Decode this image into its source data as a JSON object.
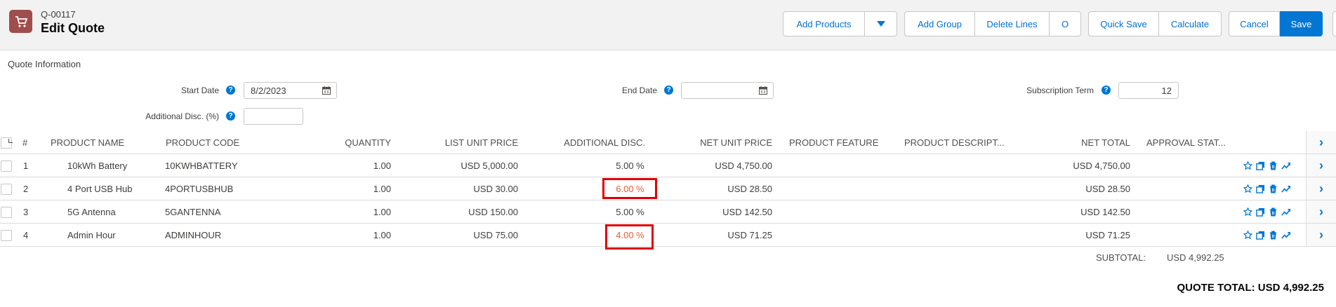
{
  "header": {
    "quote_id": "Q-00117",
    "title": "Edit Quote",
    "buttons": {
      "add_products": "Add Products",
      "add_group": "Add Group",
      "delete_lines": "Delete Lines",
      "circle": "O",
      "quick_save": "Quick Save",
      "calculate": "Calculate",
      "cancel": "Cancel",
      "save": "Save"
    }
  },
  "info": {
    "section_title": "Quote Information",
    "start_date_label": "Start Date",
    "start_date_value": "8/2/2023",
    "end_date_label": "End Date",
    "end_date_value": "",
    "subscription_term_label": "Subscription Term",
    "subscription_term_value": "12",
    "additional_disc_label": "Additional Disc. (%)",
    "additional_disc_value": ""
  },
  "table": {
    "columns": [
      "#",
      "PRODUCT NAME",
      "PRODUCT CODE",
      "QUANTITY",
      "LIST UNIT PRICE",
      "ADDITIONAL DISC.",
      "NET UNIT PRICE",
      "PRODUCT FEATURE",
      "PRODUCT DESCRIPT...",
      "NET TOTAL",
      "APPROVAL STAT..."
    ],
    "rows": [
      {
        "num": "1",
        "name": "10kWh Battery",
        "code": "10KWHBATTERY",
        "qty": "1.00",
        "list": "USD 5,000.00",
        "disc": "5.00 %",
        "net_unit": "USD 4,750.00",
        "feature": "",
        "desc": "",
        "net_total": "USD 4,750.00",
        "approval": "",
        "highlight": false
      },
      {
        "num": "2",
        "name": "4 Port USB Hub",
        "code": "4PORTUSBHUB",
        "qty": "1.00",
        "list": "USD 30.00",
        "disc": "6.00 %",
        "net_unit": "USD 28.50",
        "feature": "",
        "desc": "",
        "net_total": "USD 28.50",
        "approval": "",
        "highlight": true
      },
      {
        "num": "3",
        "name": "5G Antenna",
        "code": "5GANTENNA",
        "qty": "1.00",
        "list": "USD 150.00",
        "disc": "5.00 %",
        "net_unit": "USD 142.50",
        "feature": "",
        "desc": "",
        "net_total": "USD 142.50",
        "approval": "",
        "highlight": false
      },
      {
        "num": "4",
        "name": "Admin Hour",
        "code": "ADMINHOUR",
        "qty": "1.00",
        "list": "USD 75.00",
        "disc": "4.00 %",
        "net_unit": "USD 71.25",
        "feature": "",
        "desc": "",
        "net_total": "USD 71.25",
        "approval": "",
        "highlight": true
      }
    ]
  },
  "totals": {
    "subtotal_label": "SUBTOTAL:",
    "subtotal_value": "USD 4,992.25",
    "quote_total": "QUOTE TOTAL: USD 4,992.25"
  },
  "colors": {
    "accent": "#0176d3",
    "discount_changed": "#ec5a32",
    "highlight_box": "#e00000",
    "app_icon": "#a04d4d"
  },
  "icons": [
    "cart-icon",
    "chevron-down-icon",
    "help-icon",
    "calendar-icon",
    "star-icon",
    "clone-icon",
    "trash-icon",
    "trend-icon",
    "chevron-right-icon"
  ]
}
